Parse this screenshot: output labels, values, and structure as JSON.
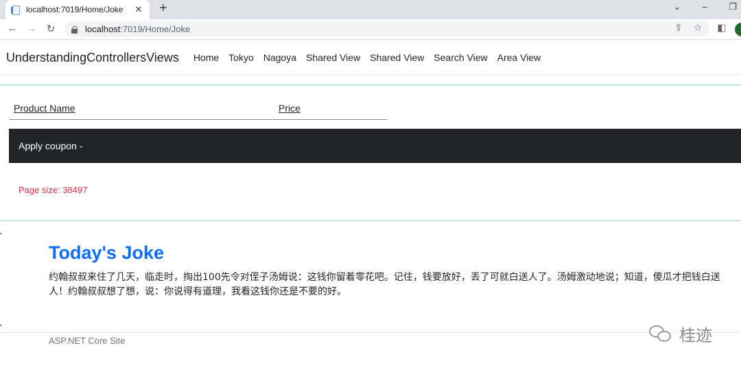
{
  "browser": {
    "tab_title": "localhost:7019/Home/Joke",
    "url_host": "localhost",
    "url_path": ":7019/Home/Joke",
    "icons": [
      "favicon-icon",
      "close-icon",
      "plus-icon",
      "back-icon",
      "forward-icon",
      "reload-icon",
      "lock-icon",
      "share-icon",
      "star-icon",
      "sidepanel-icon",
      "chevron-down-icon",
      "minimize-icon",
      "restore-icon"
    ]
  },
  "nav": {
    "brand": "UnderstandingControllersViews",
    "links": [
      "Home",
      "Tokyo",
      "Nagoya",
      "Shared View",
      "Shared View",
      "Search View",
      "Area View"
    ]
  },
  "table": {
    "columns": [
      "Product Name",
      "Price"
    ]
  },
  "coupon": {
    "label": "Apply coupon -"
  },
  "page_size": "Page size: 38497",
  "joke": {
    "title": "Today's Joke",
    "body": "约翰叔叔来住了几天，临走时，掏出100先令对侄子汤姆说：这钱你留着零花吧。记住，钱要放好，丢了可就白送人了。汤姆激动地说；知道，傻瓜才把钱白送人！约翰叔叔想了想，说：你说得有道理，我看这钱你还是不要的好。"
  },
  "footer": {
    "text": "ASP.NET Core Site"
  },
  "watermark": {
    "text": "桂迹"
  },
  "colors": {
    "link_blue": "#0d6efd",
    "danger": "#dc3545",
    "dark": "#212529",
    "teal_rule": "#bde9ee"
  }
}
